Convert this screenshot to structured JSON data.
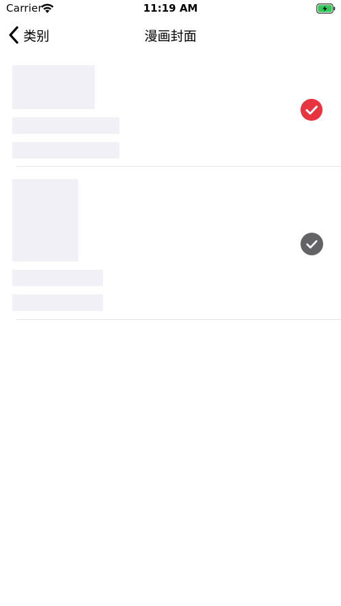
{
  "status_bar": {
    "carrier": "Carrier",
    "time": "11:19 AM",
    "battery_color": "#34c759"
  },
  "nav": {
    "back_label": "类别",
    "title": "漫画封面"
  },
  "cover_options": [
    {
      "selected": true,
      "check_color": "#e8343f"
    },
    {
      "selected": false,
      "check_color": "#636366"
    }
  ]
}
